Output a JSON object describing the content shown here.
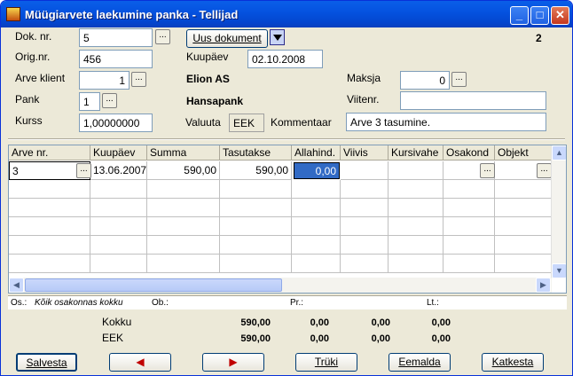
{
  "window": {
    "title": "Müügiarvete laekumine panka - Tellijad",
    "page_number": "2"
  },
  "form": {
    "dok_nr_label": "Dok. nr.",
    "dok_nr_value": "5",
    "uus_dokument_label": "Uus dokument",
    "orig_nr_label": "Orig.nr.",
    "orig_nr_value": "456",
    "kuupaev_label": "Kuupäev",
    "kuupaev_value": "02.10.2008",
    "arve_klient_label": "Arve klient",
    "arve_klient_value": "1",
    "client_name": "Elion AS",
    "maksja_label": "Maksja",
    "maksja_value": "0",
    "pank_label": "Pank",
    "pank_value": "1",
    "bank_name": "Hansapank",
    "viitenr_label": "Viitenr.",
    "viitenr_value": "",
    "kurss_label": "Kurss",
    "kurss_value": "1,00000000",
    "valuuta_label": "Valuuta",
    "valuuta_value": "EEK",
    "kommentaar_label": "Kommentaar",
    "kommentaar_value": "Arve 3 tasumine.",
    "dots": "..."
  },
  "grid": {
    "columns": [
      "Arve nr.",
      "Kuupäev",
      "Summa",
      "Tasutakse",
      "Allahind.",
      "Viivis",
      "Kursivahe",
      "Osakond",
      "Objekt"
    ],
    "row1": {
      "arve_nr": "3",
      "kuupaev": "13.06.2007",
      "summa": "590,00",
      "tasutakse": "590,00",
      "allahind": "0,00"
    }
  },
  "info": {
    "os_label": "Os.:",
    "os_value": "Kõik osakonnas kokku",
    "ob_label": "Ob.:",
    "pr_label": "Pr.:",
    "lt_label": "Lt.:"
  },
  "totals": {
    "kokku_label": "Kokku",
    "eek_label": "EEK",
    "kokku": [
      "590,00",
      "0,00",
      "0,00",
      "0,00"
    ],
    "eek": [
      "590,00",
      "0,00",
      "0,00",
      "0,00"
    ]
  },
  "buttons": {
    "salvesta": "Salvesta",
    "truki": "Trüki",
    "eemalda": "Eemalda",
    "katkesta": "Katkesta"
  }
}
